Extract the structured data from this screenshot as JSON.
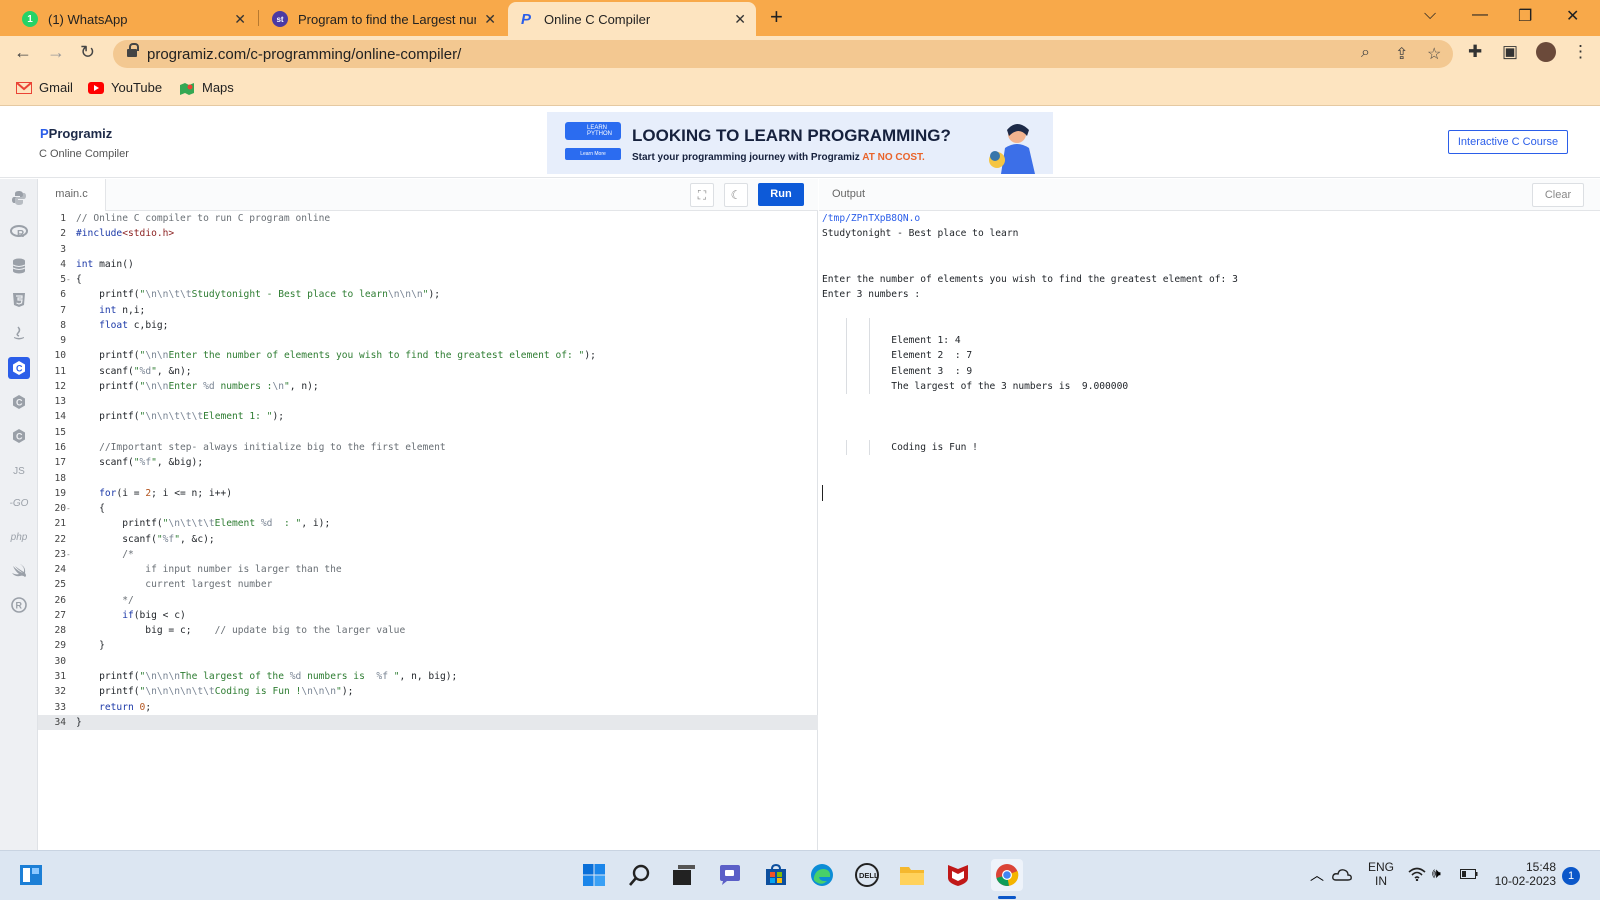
{
  "browser": {
    "tabs": [
      {
        "title": "(1) WhatsApp",
        "icon": "whatsapp-icon"
      },
      {
        "title": "Program to find the Largest num",
        "icon": "studytonight-icon"
      },
      {
        "title": "Online C Compiler",
        "icon": "programiz-icon"
      }
    ],
    "url": "programiz.com/c-programming/online-compiler/",
    "bookmarks": [
      {
        "label": "Gmail",
        "icon": "gmail-icon"
      },
      {
        "label": "YouTube",
        "icon": "youtube-icon"
      },
      {
        "label": "Maps",
        "icon": "maps-icon"
      }
    ]
  },
  "site": {
    "logo": "Programiz",
    "subtitle": "C Online Compiler",
    "banner_badge": "LEARN PYTHON",
    "banner_learn_more": "Learn More",
    "banner_heading": "LOOKING TO LEARN PROGRAMMING?",
    "banner_sub": "Start your programming journey with Programiz",
    "banner_emphasis": "AT NO COST.",
    "course_button": "Interactive C Course"
  },
  "editor": {
    "file_tab": "main.c",
    "run_label": "Run",
    "code_lines": [
      "// Online C compiler to run C program online",
      "#include<stdio.h>",
      "",
      "int main()",
      "{",
      "    printf(\"\\n\\n\\t\\tStudytonight - Best place to learn\\n\\n\\n\");",
      "    int n,i;",
      "    float c,big;",
      "",
      "    printf(\"\\n\\nEnter the number of elements you wish to find the greatest element of: \");",
      "    scanf(\"%d\", &n);",
      "    printf(\"\\n\\nEnter %d numbers :\\n\", n);",
      "",
      "    printf(\"\\n\\n\\t\\t\\tElement 1: \");",
      "",
      "    //Important step- always initialize big to the first element",
      "    scanf(\"%f\", &big);",
      "",
      "    for(i = 2; i <= n; i++)",
      "    {",
      "        printf(\"\\n\\t\\t\\tElement %d  : \", i);",
      "        scanf(\"%f\", &c);",
      "        /*",
      "            if input number is larger than the",
      "            current largest number",
      "        */",
      "        if(big < c)",
      "            big = c;    // update big to the larger value",
      "    }",
      "",
      "    printf(\"\\n\\n\\nThe largest of the %d numbers is  %f \", n, big);",
      "    printf(\"\\n\\n\\n\\n\\t\\tCoding is Fun !\\n\\n\\n\");",
      "    return 0;",
      "}"
    ],
    "fold_lines": [
      5,
      20,
      23
    ],
    "current_line": 34
  },
  "output": {
    "label": "Output",
    "clear_label": "Clear",
    "lines": [
      {
        "text": "/tmp/ZPnTXpB8QN.o",
        "kind": "path"
      },
      {
        "text": "Studytonight - Best place to learn"
      },
      {
        "text": ""
      },
      {
        "text": ""
      },
      {
        "text": "Enter the number of elements you wish to find the greatest element of: 3"
      },
      {
        "text": "Enter 3 numbers :"
      },
      {
        "text": ""
      },
      {
        "text": "",
        "guides": true
      },
      {
        "text": "            Element 1: 4",
        "guides": true
      },
      {
        "text": "            Element 2  : 7",
        "guides": true
      },
      {
        "text": "            Element 3  : 9",
        "guides": true
      },
      {
        "text": "            The largest of the 3 numbers is  9.000000",
        "guides": true
      },
      {
        "text": ""
      },
      {
        "text": ""
      },
      {
        "text": ""
      },
      {
        "text": "            Coding is Fun !",
        "guides": true
      }
    ]
  },
  "taskbar": {
    "lang_top": "ENG",
    "lang_bottom": "IN",
    "time": "15:48",
    "date": "10-02-2023",
    "notifications": "1"
  },
  "colors": {
    "tabbar": "#f8a94a",
    "toolbar": "#fde4c0",
    "accent": "#2b5ee9",
    "run": "#0d5ad8"
  }
}
